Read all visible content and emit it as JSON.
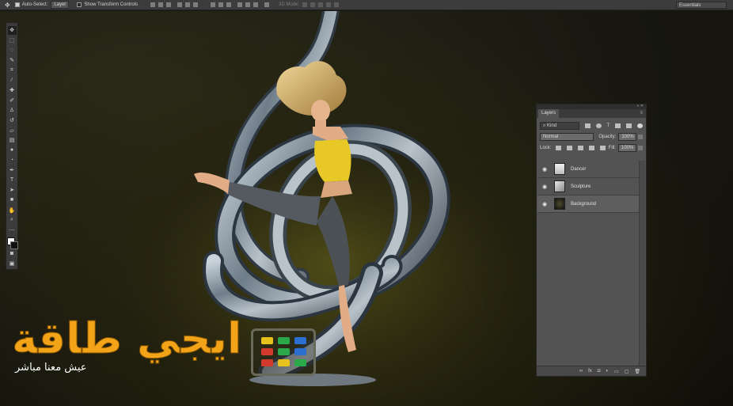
{
  "options_bar": {
    "auto_select_label": "Auto-Select:",
    "auto_select_target": "Layer",
    "transform_controls_label": "Show Transform Controls",
    "mode_3d_label": "3D Mode:",
    "workspace": "Essentials"
  },
  "layers_panel": {
    "tab_label": "Layers",
    "filter_kind": "Kind",
    "blend_mode": "Normal",
    "opacity_label": "Opacity:",
    "opacity_value": "100%",
    "lock_label": "Lock:",
    "fill_label": "Fill:",
    "fill_value": "100%",
    "layers": [
      {
        "name": "Dancer",
        "visible": true
      },
      {
        "name": "Sculpture",
        "visible": true
      },
      {
        "name": "Background",
        "visible": true
      }
    ],
    "bottom_icons": [
      "link-icon",
      "fx-icon",
      "mask-icon",
      "adjustment-icon",
      "group-icon",
      "new-layer-icon",
      "trash-icon"
    ]
  },
  "watermark": {
    "name": "ايجي طاقة",
    "tagline": "عيش معنا مباشر",
    "tv_colors": [
      "#e8c21c",
      "#2aa84a",
      "#2b6fd1",
      "#d23b2b",
      "#2aa84a",
      "#2b6fd1",
      "#d23b2b",
      "#e8c21c",
      "#2aa84a"
    ]
  },
  "colors": {
    "accent_watermark": "#f3a318",
    "dancer_top": "#e8c826",
    "sculpture_metal": "#8a97a3"
  }
}
